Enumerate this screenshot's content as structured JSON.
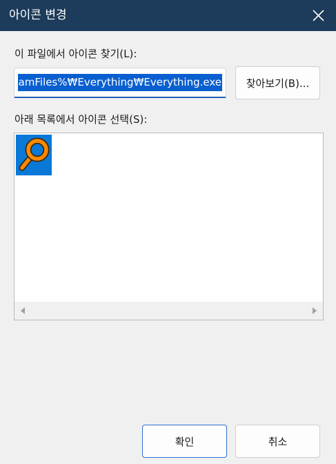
{
  "window": {
    "title": "아이콘 변경"
  },
  "labels": {
    "path_label": "이 파일에서 아이콘 찾기(L):",
    "list_label": "아래 목록에서 아이콘 선택(S):"
  },
  "path_input": {
    "value": "amFiles%₩Everything₩Everything.exe"
  },
  "buttons": {
    "browse": "찾아보기(B)...",
    "ok": "확인",
    "cancel": "취소"
  },
  "icons": {
    "items": [
      {
        "name": "everything-magnifier-icon",
        "selected": true
      }
    ]
  },
  "colors": {
    "titlebar": "#1d3b5a",
    "selection": "#0a5fd0",
    "icon_selected_bg": "#0a78d7",
    "magnifier_orange": "#ff8a00"
  }
}
